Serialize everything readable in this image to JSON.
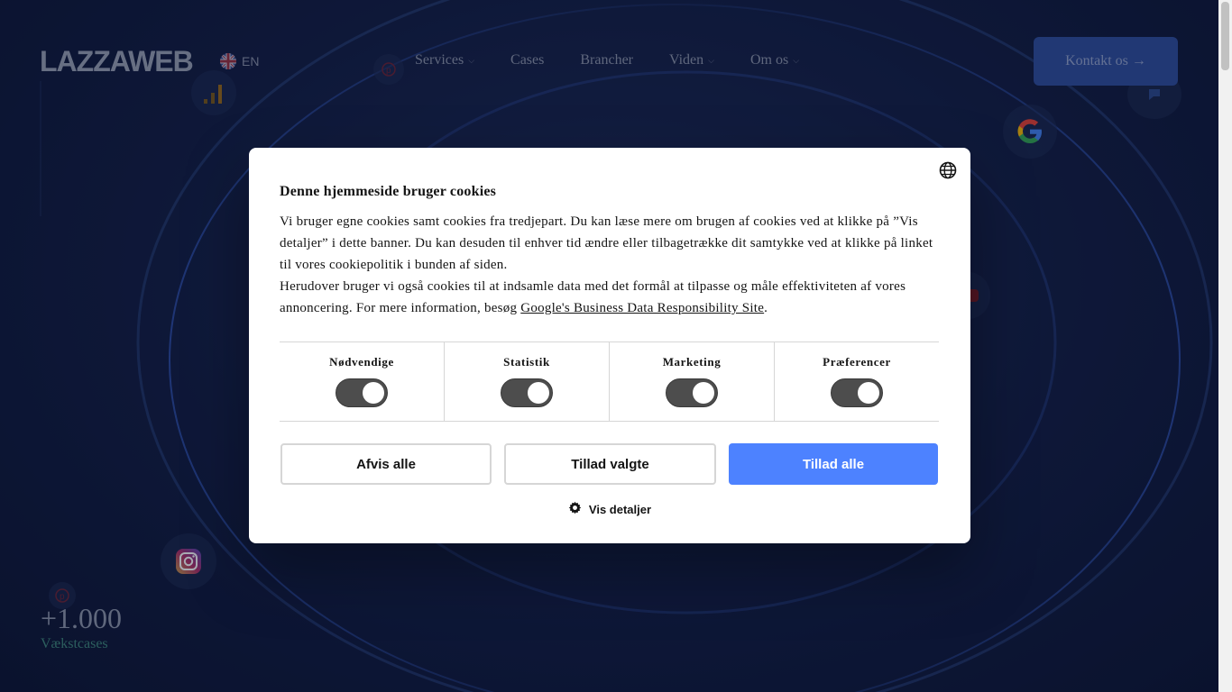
{
  "header": {
    "logo": "LAZZAWEB",
    "language": "EN",
    "nav": [
      {
        "label": "Services",
        "dropdown": true
      },
      {
        "label": "Cases",
        "dropdown": false
      },
      {
        "label": "Brancher",
        "dropdown": false
      },
      {
        "label": "Viden",
        "dropdown": true
      },
      {
        "label": "Om os",
        "dropdown": true
      }
    ],
    "cta": "Kontakt os →"
  },
  "hero": {
    "stat_number": "+1.000",
    "stat_label": "Vækstcases"
  },
  "background_icons": [
    "pinterest-icon",
    "analytics-icon",
    "google-icon",
    "youtube-icon",
    "instagram-icon",
    "pinterest-icon"
  ],
  "cookie_dialog": {
    "title": "Denne hjemmeside bruger cookies",
    "paragraph1": "Vi bruger egne cookies samt cookies fra tredjepart. Du kan læse mere om brugen af cookies ved at klikke på ”Vis detaljer” i dette banner. Du kan desuden til enhver tid ændre eller tilbagetrække dit samtykke ved at klikke på linket til vores cookiepolitik i bunden af siden.",
    "paragraph2_prefix": "Herudover bruger vi også cookies til at indsamle data med det formål at tilpasse og måle effektiviteten af vores annoncering. For mere information, besøg ",
    "paragraph2_link": "Google's Business Data Responsibility Site",
    "paragraph2_suffix": ".",
    "categories": [
      {
        "label": "Nødvendige",
        "enabled": true
      },
      {
        "label": "Statistik",
        "enabled": true
      },
      {
        "label": "Marketing",
        "enabled": true
      },
      {
        "label": "Præferencer",
        "enabled": true
      }
    ],
    "buttons": {
      "reject": "Afvis alle",
      "allow_selected": "Tillad valgte",
      "allow_all": "Tillad alle"
    },
    "details_link": "Vis detaljer"
  },
  "colors": {
    "primary_button": "#4d82ff",
    "toggle_on": "#4d4d4d",
    "page_background": "#0f1a3a",
    "cta_background": "#2f4f9e"
  }
}
